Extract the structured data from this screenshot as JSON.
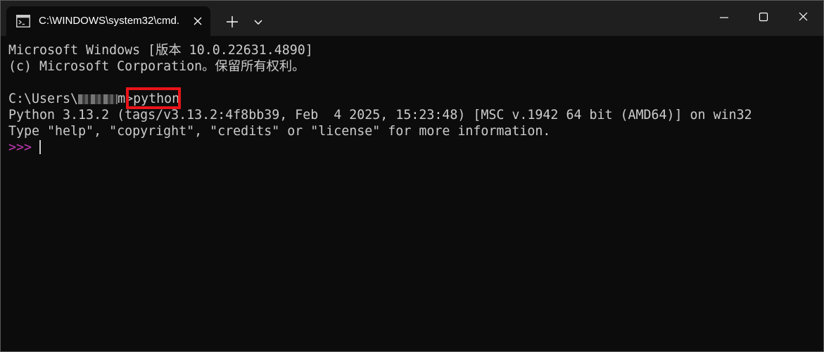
{
  "tab": {
    "title": "C:\\WINDOWS\\system32\\cmd."
  },
  "terminal": {
    "lines": [
      "Microsoft Windows [版本 10.0.22631.4890]",
      "(c) Microsoft Corporation。保留所有权利。",
      "",
      "",
      "Python 3.13.2 (tags/v3.13.2:4f8bb39, Feb  4 2025, 15:23:48) [MSC v.1942 64 bit (AMD64)] on win32",
      "Type \"help\", \"copyright\", \"credits\" or \"license\" for more information."
    ],
    "prompt_path_prefix": "C:\\Users\\",
    "prompt_path_suffix": "m>",
    "command": "python",
    "repl_prompt": ">>> "
  },
  "colors": {
    "background": "#0c0c0c",
    "titlebar": "#1f1f1f",
    "text": "#cccccc",
    "repl_prompt": "#c239b3",
    "highlight_box": "#e8141a"
  },
  "icons": {
    "tab_icon": "terminal-icon",
    "tab_close": "close-icon",
    "new_tab": "plus-icon",
    "dropdown": "chevron-down-icon",
    "minimize": "minimize-icon",
    "maximize": "maximize-icon",
    "close": "close-icon"
  }
}
